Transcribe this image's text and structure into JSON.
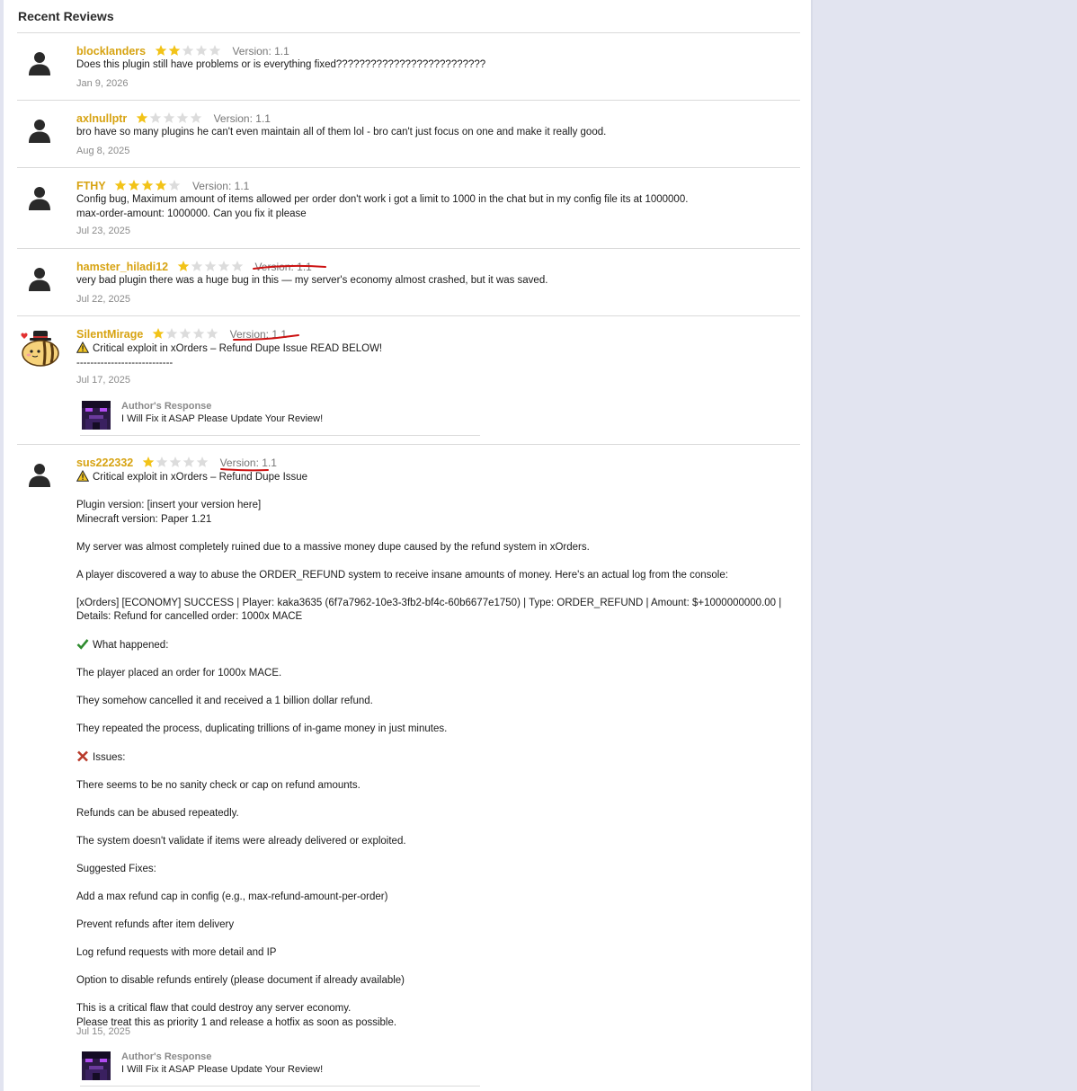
{
  "section_title": "Recent Reviews",
  "reviews": [
    {
      "username": "blocklanders",
      "rating": 2,
      "version": "Version: 1.1",
      "body": [
        "Does this plugin still have problems or is everything fixed??????????????????????????"
      ],
      "date": "Jan 9, 2026"
    },
    {
      "username": "axlnullptr",
      "rating": 1,
      "version": "Version: 1.1",
      "body": [
        "bro have so many plugins he can't even maintain all of them lol - bro can't just focus on one and make it really good."
      ],
      "date": "Aug 8, 2025"
    },
    {
      "username": "FTHY",
      "rating": 4,
      "version": "Version: 1.1",
      "body": [
        "Config bug, Maximum amount of items allowed per order don't work i got a limit to 1000 in the chat but in my config file its at 1000000.",
        "max-order-amount: 1000000. Can you fix it please"
      ],
      "date": "Jul 23, 2025"
    },
    {
      "username": "hamster_hiladi12",
      "rating": 1,
      "version": "Version: 1.1",
      "body": [
        "very bad plugin there was a huge bug in this — my server's economy almost crashed, but it was saved."
      ],
      "date": "Jul 22, 2025"
    },
    {
      "username": "SilentMirage",
      "rating": 1,
      "version": "Version: 1.1",
      "body": [
        "Critical exploit in xOrders – Refund Dupe Issue READ BELOW!",
        "----------------------------"
      ],
      "date": "Jul 17, 2025",
      "response": {
        "title": "Author's Response",
        "text": "I Will Fix it ASAP Please Update Your Review!"
      }
    },
    {
      "username": "sus222332",
      "rating": 1,
      "version": "Version: 1.1",
      "body": [
        "Critical exploit in xOrders – Refund Dupe Issue",
        "",
        "Plugin version: [insert your version here]",
        "Minecraft version: Paper 1.21",
        "",
        "My server was almost completely ruined due to a massive money dupe caused by the refund system in xOrders.",
        "",
        "A player discovered a way to abuse the ORDER_REFUND system to receive insane amounts of money. Here's an actual log from the console:",
        "",
        "[xOrders] [ECONOMY] SUCCESS | Player: kaka3635 (6f7a7962-10e3-3fb2-bf4c-60b6677e1750) | Type: ORDER_REFUND | Amount: $+1000000000.00 |",
        "Details: Refund for cancelled order: 1000x MACE",
        "",
        "What happened:",
        "",
        "The player placed an order for 1000x MACE.",
        "",
        "They somehow cancelled it and received a 1 billion dollar refund.",
        "",
        "They repeated the process, duplicating trillions of in-game money in just minutes.",
        "",
        "Issues:",
        "",
        "There seems to be no sanity check or cap on refund amounts.",
        "",
        "Refunds can be abused repeatedly.",
        "",
        "The system doesn't validate if items were already delivered or exploited.",
        "",
        "Suggested Fixes:",
        "",
        "Add a max refund cap in config (e.g., max-refund-amount-per-order)",
        "",
        "Prevent refunds after item delivery",
        "",
        "Log refund requests with more detail and IP",
        "",
        "Option to disable refunds entirely (please document if already available)",
        "",
        "This is a critical flaw that could destroy any server economy.",
        "Please treat this as priority 1 and release a hotfix as soon as possible."
      ],
      "date": "Jul 15, 2025",
      "response": {
        "title": "Author's Response",
        "text": "I Will Fix it ASAP Please Update Your Review!"
      }
    }
  ],
  "colors": {
    "star_on": "#f2c318",
    "star_off": "#dcdcdc",
    "username": "#d7a312",
    "annotation": "#cc1111"
  }
}
